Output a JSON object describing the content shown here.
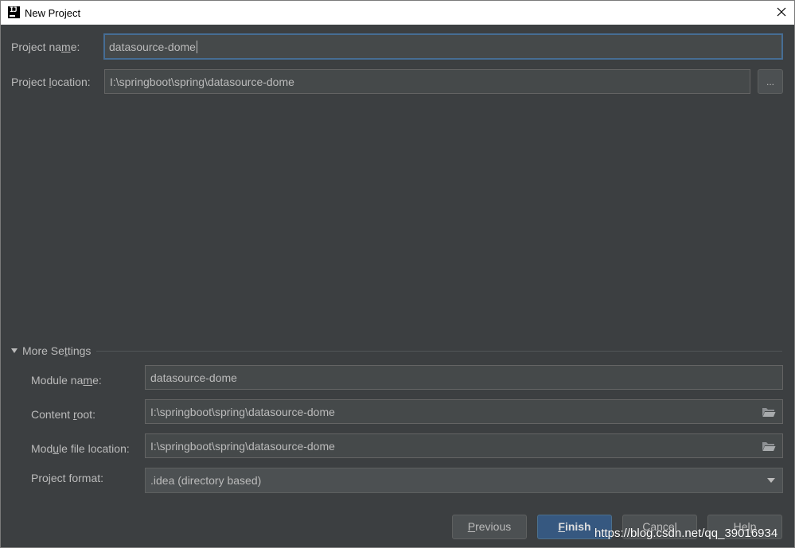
{
  "window": {
    "title": "New Project",
    "app_icon": "intellij-icon",
    "close_icon": "close-icon"
  },
  "project": {
    "name_label_pre": "Project na",
    "name_label_u": "m",
    "name_label_post": "e:",
    "name_value": "datasource-dome",
    "location_label_pre": "Project ",
    "location_label_u": "l",
    "location_label_post": "ocation:",
    "location_value": "I:\\springboot\\spring\\datasource-dome",
    "browse_label": "..."
  },
  "more_settings": {
    "toggle_label_pre": "More Se",
    "toggle_label_u": "t",
    "toggle_label_post": "tings",
    "module_name_label_pre": "Module na",
    "module_name_label_u": "m",
    "module_name_label_post": "e:",
    "module_name_value": "datasource-dome",
    "content_root_label_pre": "Content ",
    "content_root_label_u": "r",
    "content_root_label_post": "oot:",
    "content_root_value": "I:\\springboot\\spring\\datasource-dome",
    "module_file_label_pre": "Mod",
    "module_file_label_u": "u",
    "module_file_label_post": "le file location:",
    "module_file_value": "I:\\springboot\\spring\\datasource-dome",
    "project_format_label": "Project format:",
    "project_format_value": ".idea (directory based)"
  },
  "buttons": {
    "previous_u": "P",
    "previous_rest": "revious",
    "finish_u": "F",
    "finish_rest": "inish",
    "cancel": "Cancel",
    "help": "Help"
  },
  "watermark": "https://blog.csdn.net/qq_39016934",
  "colors": {
    "background": "#3c3f41",
    "field_bg": "#45494a",
    "focus_border": "#466d94",
    "primary_button": "#365880",
    "text": "#bbbbbb"
  }
}
